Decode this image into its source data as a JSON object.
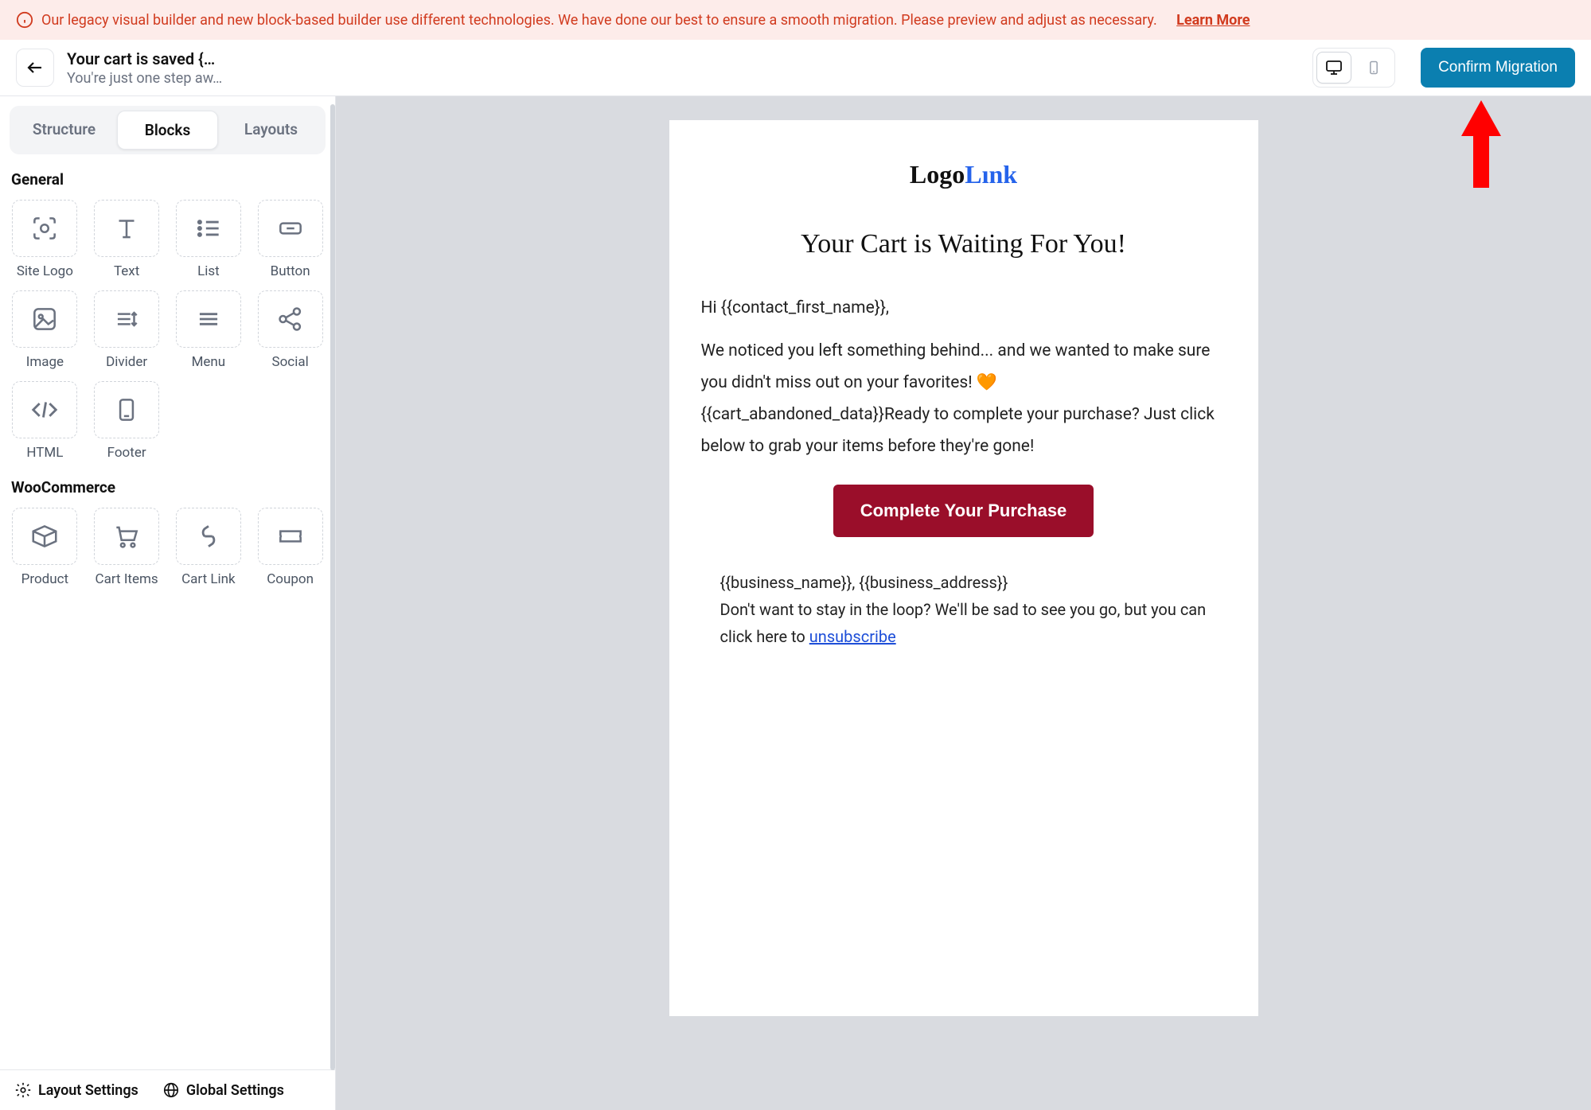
{
  "banner": {
    "text": "Our legacy visual builder and new block-based builder use different technologies. We have done our best to ensure a smooth migration. Please preview and adjust as necessary.",
    "learn_more": "Learn More"
  },
  "header": {
    "title": "Your cart is saved {…",
    "subtitle": "You're just one step aw…",
    "confirm_label": "Confirm Migration"
  },
  "tabs": {
    "structure": "Structure",
    "blocks": "Blocks",
    "layouts": "Layouts"
  },
  "sections": {
    "general": "General",
    "woocommerce": "WooCommerce"
  },
  "blocks": {
    "site_logo": "Site Logo",
    "text": "Text",
    "list": "List",
    "button": "Button",
    "image": "Image",
    "divider": "Divider",
    "menu": "Menu",
    "social": "Social",
    "html": "HTML",
    "footer": "Footer",
    "product": "Product",
    "cart_items": "Cart Items",
    "cart_link": "Cart Link",
    "coupon": "Coupon"
  },
  "footer_links": {
    "layout_settings": "Layout Settings",
    "global_settings": "Global Settings"
  },
  "email": {
    "logo_part1": "Logo",
    "logo_part2": "Lınk",
    "heading": "Your Cart is Waiting For You!",
    "greeting": "Hi {{contact_first_name}},",
    "body_part1": "We noticed you left something behind... and we wanted to make sure you didn't miss out on your favorites! ",
    "body_part2": " {{cart_abandoned_data}}Ready to complete your purchase? Just click below to grab your items before they're gone!",
    "cta": "Complete Your Purchase",
    "footer_line1": "{{business_name}}, {{business_address}}",
    "footer_line2a": "Don't want to stay in the loop? We'll be sad to see you go, but you can click here to ",
    "footer_unsub": "unsubscribe"
  }
}
